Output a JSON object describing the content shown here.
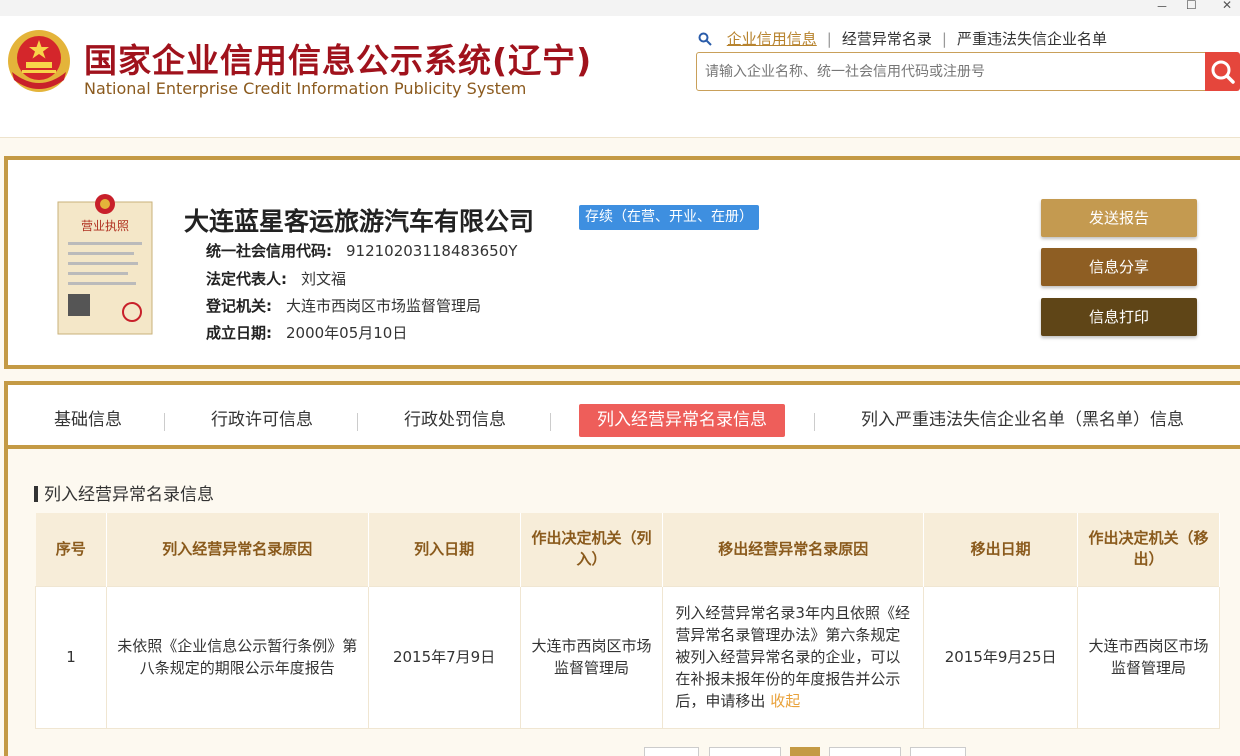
{
  "window_controls": {
    "minimize": "－",
    "maximize": "☐",
    "close": "✕"
  },
  "header": {
    "title_main": "国家企业信用信息公示系统",
    "title_province": "(辽宁)",
    "title_en": "National Enterprise Credit Information Publicity System",
    "links": [
      "企业信用信息",
      "经营异常名录",
      "严重违法失信企业名单"
    ],
    "search_placeholder": "请输入企业名称、统一社会信用代码或注册号"
  },
  "company": {
    "name": "大连蓝星客运旅游汽车有限公司",
    "status": "存续（在营、开业、在册）",
    "fields": [
      {
        "label": "统一社会信用代码:",
        "value": "91210203118483650Y"
      },
      {
        "label": "法定代表人:",
        "value": "刘文福"
      },
      {
        "label": "登记机关:",
        "value": "大连市西岗区市场监督管理局"
      },
      {
        "label": "成立日期:",
        "value": "2000年05月10日"
      }
    ],
    "license_label": "营业执照",
    "actions": {
      "send": "发送报告",
      "share": "信息分享",
      "print": "信息打印"
    }
  },
  "tabs": [
    "基础信息",
    "行政许可信息",
    "行政处罚信息",
    "列入经营异常名录信息",
    "列入严重违法失信企业名单（黑名单）信息"
  ],
  "section": {
    "title": "列入经营异常名录信息",
    "columns": [
      "序号",
      "列入经营异常名录原因",
      "列入日期",
      "作出决定机关（列入）",
      "移出经营异常名录原因",
      "移出日期",
      "作出决定机关（移出）"
    ],
    "rows": [
      {
        "index": "1",
        "reason_in": "未依照《企业信息公示暂行条例》第八条规定的期限公示年度报告",
        "date_in": "2015年7月9日",
        "authority_in": "大连市西岗区市场监督管理局",
        "reason_out": "列入经营异常名录3年内且依照《经营异常名录管理办法》第六条规定被列入经营异常名录的企业，可以在补报未报年份的年度报告并公示后，申请移出",
        "reason_out_link": "收起",
        "date_out": "2015年9月25日",
        "authority_out": "大连市西岗区市场监督管理局"
      }
    ]
  },
  "colors": {
    "brand_red": "#a0121c",
    "gold": "#c49a45",
    "status_blue": "#3e8fe0",
    "active_tab": "#ee5e5a",
    "search_red": "#e5463c"
  }
}
